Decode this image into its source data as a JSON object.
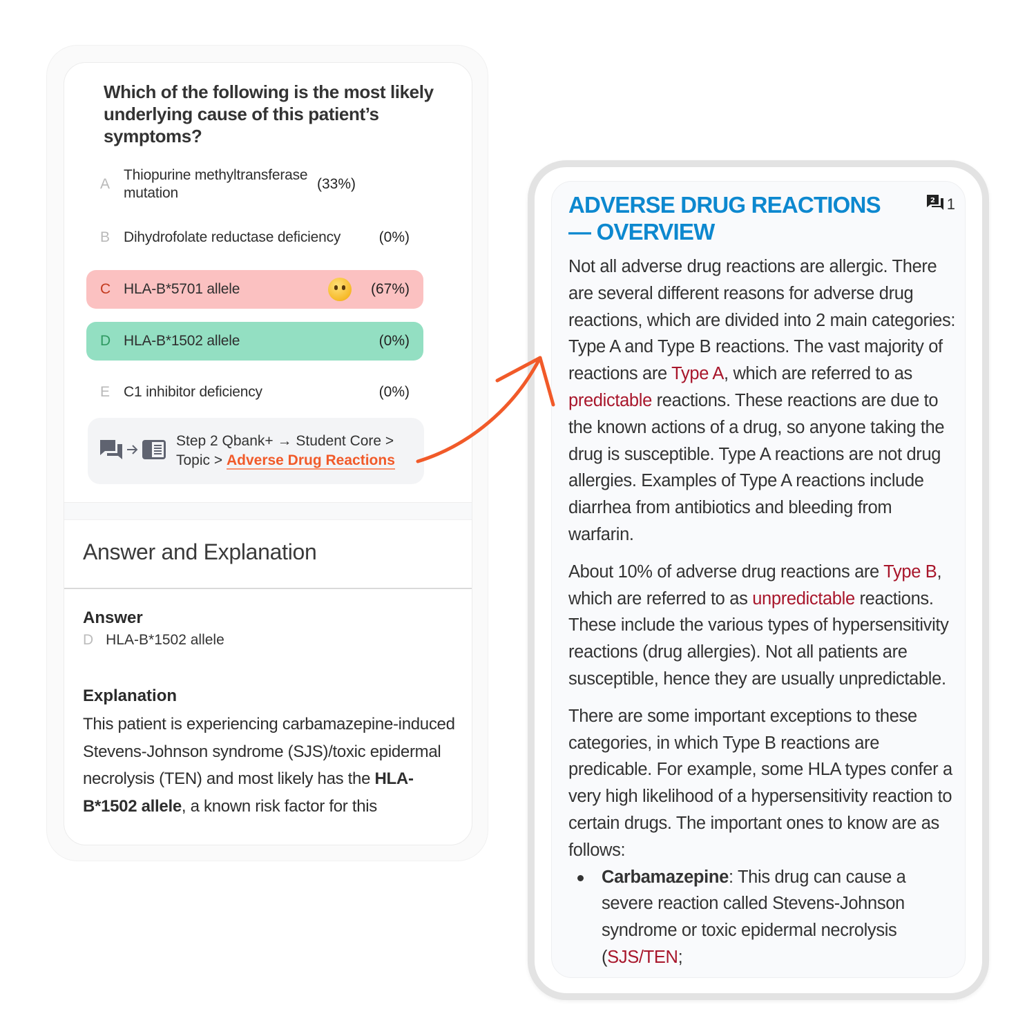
{
  "question": {
    "text": "Which of the following is the most likely underlying cause of this patient’s symptoms?",
    "options": [
      {
        "letter": "A",
        "text": "Thiopurine methyltransferase mutation",
        "percent": "(33%)",
        "state": "default"
      },
      {
        "letter": "B",
        "text": "Dihydrofolate reductase deficiency",
        "percent": "(0%)",
        "state": "default"
      },
      {
        "letter": "C",
        "text": "HLA-B*5701 allele",
        "percent": "(67%)",
        "state": "incorrect",
        "emoji": "thinking-face"
      },
      {
        "letter": "D",
        "text": "HLA-B*1502 allele",
        "percent": "(0%)",
        "state": "correct"
      },
      {
        "letter": "E",
        "text": "C1 inhibitor deficiency",
        "percent": "(0%)",
        "state": "default"
      }
    ]
  },
  "breadcrumb": {
    "icons": [
      "qbank-chat-icon",
      "arrow-right-icon",
      "article-icon"
    ],
    "path": "Step 2 Qbank+ → Student Core >",
    "path2": "Topic >",
    "link": "Adverse Drug Reactions"
  },
  "answer_section": {
    "title": "Answer and Explanation",
    "answer_heading": "Answer",
    "answer_letter": "D",
    "answer_text": "HLA-B*1502 allele",
    "explanation_heading": "Explanation",
    "explanation_pre": "This patient is experiencing carbamazepine-induced Stevens-Johnson syndrome (SJS)/toxic epidermal necrolysis (TEN) and most likely has the ",
    "explanation_bold": "HLA-B*1502 allele",
    "explanation_post": ", a known risk factor for this"
  },
  "article": {
    "title": "ADVERSE DRUG REACTIONS — OVERVIEW",
    "comment_count": "1",
    "p1": {
      "a": "Not all adverse drug reactions are allergic. There are several different reasons for adverse drug reactions, which are divided into 2 main categories: Type A and Type B reactions. The vast majority of reactions are ",
      "hl1": "Type A",
      "b": ", which are referred to as ",
      "hl2": "predictable",
      "c": " reactions. These reactions are due to the known actions of a drug, so anyone taking the drug is susceptible. Type A reactions are not drug allergies. Examples of Type A reactions include diarrhea from antibiotics and bleeding from warfarin."
    },
    "p2": {
      "a": "About 10% of adverse drug reactions are ",
      "hl1": "Type B",
      "b": ", which are referred to as ",
      "hl2": "unpredictable",
      "c": " reactions. These include the various types of hypersensitivity reactions (drug allergies). Not all patients are susceptible, hence they are usually unpredictable."
    },
    "p3": "There are some important exceptions to these categories, in which Type B reactions are predicable. For example, some HLA types confer a very high likelihood of a hypersensitivity reaction to certain drugs. The important ones to know are as follows:",
    "bullet": {
      "bold": "Carbamazepine",
      "a": ": This drug can cause a severe reaction called Stevens-Johnson syndrome or toxic epidermal necrolysis (",
      "hl": "SJS/TEN",
      "b": ";"
    }
  },
  "colors": {
    "accent_orange": "#f15a29",
    "title_blue": "#0d88cf",
    "highlight_red": "#a8162b",
    "incorrect_bg": "#fbc1c1",
    "correct_bg": "#93dfc2"
  }
}
